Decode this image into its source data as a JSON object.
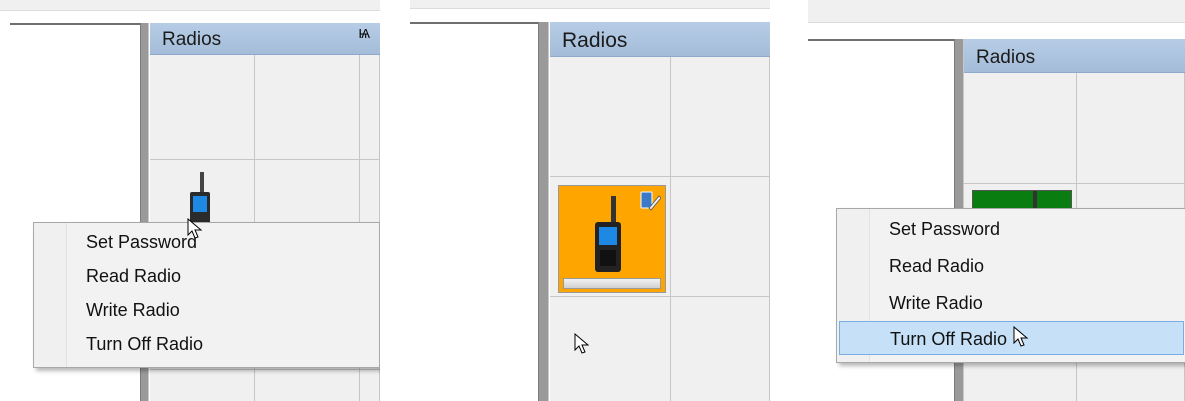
{
  "panels": [
    {
      "header": {
        "title": "Radios",
        "pin_icon": "pin-icon",
        "pin_glyph": "Ѩ"
      },
      "menu": {
        "items": [
          "Set Password",
          "Read Radio",
          "Write Radio",
          "Turn Off Radio"
        ],
        "highlighted": null
      }
    },
    {
      "header": {
        "title": "Radios"
      },
      "radio_tile": {
        "color": "#ffa500",
        "icon": "radio-icon",
        "badge": "edit-badge-icon"
      }
    },
    {
      "header": {
        "title": "Radios"
      },
      "radio_tile": {
        "color": "#0a7d10"
      },
      "menu": {
        "items": [
          "Set Password",
          "Read Radio",
          "Write Radio",
          "Turn Off Radio"
        ],
        "highlighted": "Turn Off Radio"
      }
    }
  ],
  "colors": {
    "header_bg": "#a9c0dc",
    "menu_highlight": "#c6e1f7",
    "tile_orange": "#ffa500",
    "tile_green": "#0a7d10"
  }
}
